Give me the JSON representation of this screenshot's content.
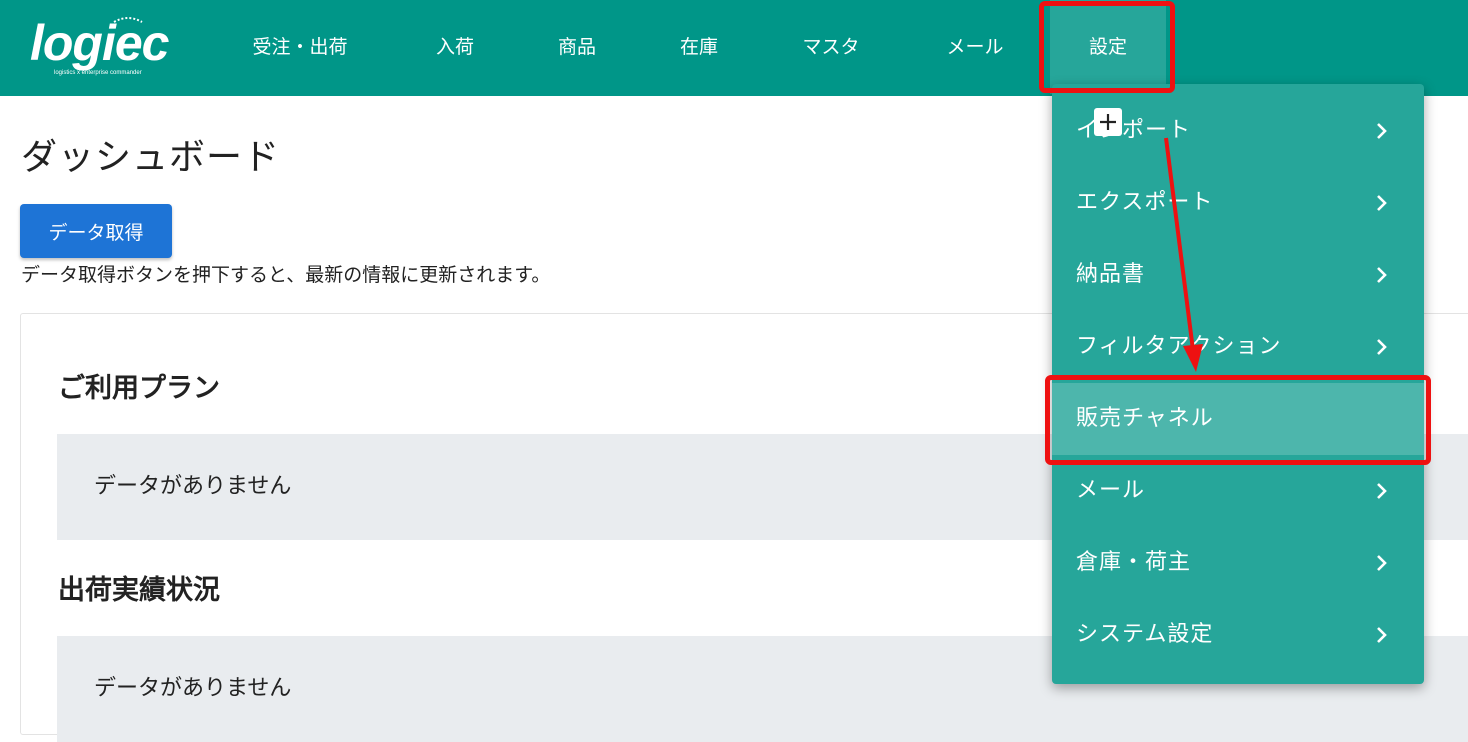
{
  "header": {
    "logo_text": "logiec",
    "logo_tagline": "logistics x enterprise commander",
    "nav": [
      {
        "label": "受注・出荷"
      },
      {
        "label": "入荷"
      },
      {
        "label": "商品"
      },
      {
        "label": "在庫"
      },
      {
        "label": "マスタ"
      },
      {
        "label": "メール"
      },
      {
        "label": "設定"
      }
    ],
    "active_nav": "設定"
  },
  "main": {
    "title": "ダッシュボード",
    "fetch_button": "データ取得",
    "help_text": "データ取得ボタンを押下すると、最新の情報に更新されます。",
    "sections": [
      {
        "title": "ご利用プラン",
        "empty_text": "データがありません"
      },
      {
        "title": "出荷実績状況",
        "empty_text": "データがありません"
      }
    ]
  },
  "settings_menu": {
    "items": [
      {
        "label": "インポート",
        "has_submenu": true
      },
      {
        "label": "エクスポート",
        "has_submenu": true
      },
      {
        "label": "納品書",
        "has_submenu": true
      },
      {
        "label": "フィルタアクション",
        "has_submenu": true
      },
      {
        "label": "販売チャネル",
        "has_submenu": false,
        "highlighted": true
      },
      {
        "label": "メール",
        "has_submenu": true
      },
      {
        "label": "倉庫・荷主",
        "has_submenu": true
      },
      {
        "label": "システム設定",
        "has_submenu": true
      }
    ]
  },
  "colors": {
    "header_bg": "#009688",
    "menu_bg": "#26a69a",
    "highlight_bg": "#4db6ac",
    "primary_button": "#1e74d6",
    "annotation_red": "#ee1111"
  },
  "icons": [
    "plus-icon",
    "chevron-right-icon",
    "annotation-arrow"
  ]
}
